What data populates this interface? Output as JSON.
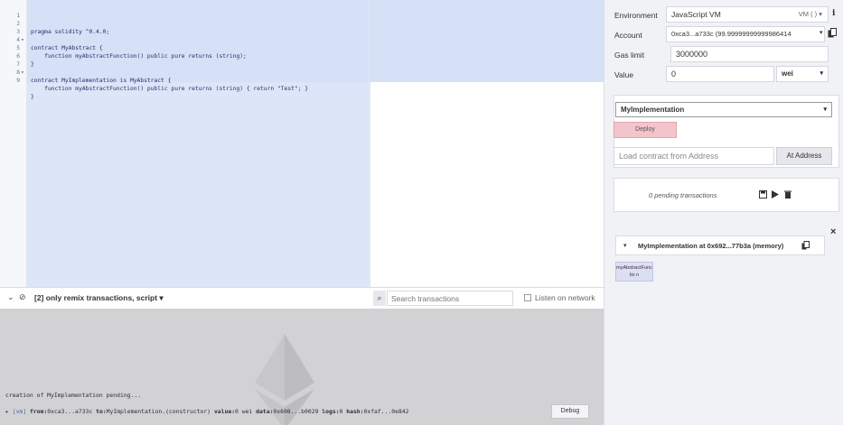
{
  "editor": {
    "lines": [
      {
        "n": "1",
        "fold": "",
        "text": "pragma solidity ^0.4.0;"
      },
      {
        "n": "2",
        "fold": "",
        "text": ""
      },
      {
        "n": "3",
        "fold": "▾",
        "text": "contract MyAbstract {"
      },
      {
        "n": "4",
        "fold": "",
        "text": "    function myAbstractFunction() public pure returns (string);"
      },
      {
        "n": "5",
        "fold": "",
        "text": "}"
      },
      {
        "n": "6",
        "fold": "",
        "text": ""
      },
      {
        "n": "7",
        "fold": "▾",
        "text": "contract MyImplementation is MyAbstract {"
      },
      {
        "n": "8",
        "fold": "",
        "text": "    function myAbstractFunction() public pure returns (string) { return \"Test\"; }"
      },
      {
        "n": "9",
        "fold": "",
        "text": "}"
      }
    ]
  },
  "terminal_bar": {
    "collapse_icon": "⌄",
    "clear_icon": "⊘",
    "filter_label": "[2] only remix transactions, script",
    "filter_caret": "▾",
    "search_icon": "⌕",
    "search_placeholder": "Search transactions",
    "listen_label": "Listen on network"
  },
  "terminal": {
    "pending_message": "creation of MyImplementation pending...",
    "tx": {
      "arrow": "▸",
      "tag": "[vm]",
      "from_key": "from:",
      "from_val": "0xca3...a733c",
      "to_key": "to:",
      "to_val": "MyImplementation.(constructor)",
      "value_key": "value:",
      "value_val": "0 wei",
      "data_key": "data:",
      "data_val": "0x608...b0029",
      "logs_key": "logs:",
      "logs_val": "0",
      "hash_key": "hash:",
      "hash_val": "0xfaf...0e842"
    },
    "debug_label": "Debug"
  },
  "run_panel": {
    "environment_label": "Environment",
    "environment_value": "JavaScript VM",
    "environment_badge": "VM ( ) ▾",
    "info_icon": "i",
    "account_label": "Account",
    "account_value": "0xca3...a733c (99.99999999999986414",
    "account_caret": "▾",
    "gas_limit_label": "Gas limit",
    "gas_limit_value": "3000000",
    "value_label": "Value",
    "value_amount": "0",
    "value_unit": "wei",
    "unit_caret": "▾",
    "contract_select": "MyImplementation",
    "contract_caret": "▾",
    "deploy_label": "Deploy",
    "load_address_placeholder": "Load contract from Address",
    "at_address_label": "At Address",
    "pending_tx": "0 pending transactions",
    "close_icon": "×",
    "instance_toggle": "▾",
    "instance_label": "MyImplementation at 0x692...77b3a (memory)",
    "instance_fn_label": "myAbstractFunctio n"
  },
  "colors": {
    "selection": "#d6e0f6",
    "deploy_button": "#f4c4cb",
    "terminal_bg": "#d2d2d4",
    "panel_bg": "#f1f2f6"
  }
}
